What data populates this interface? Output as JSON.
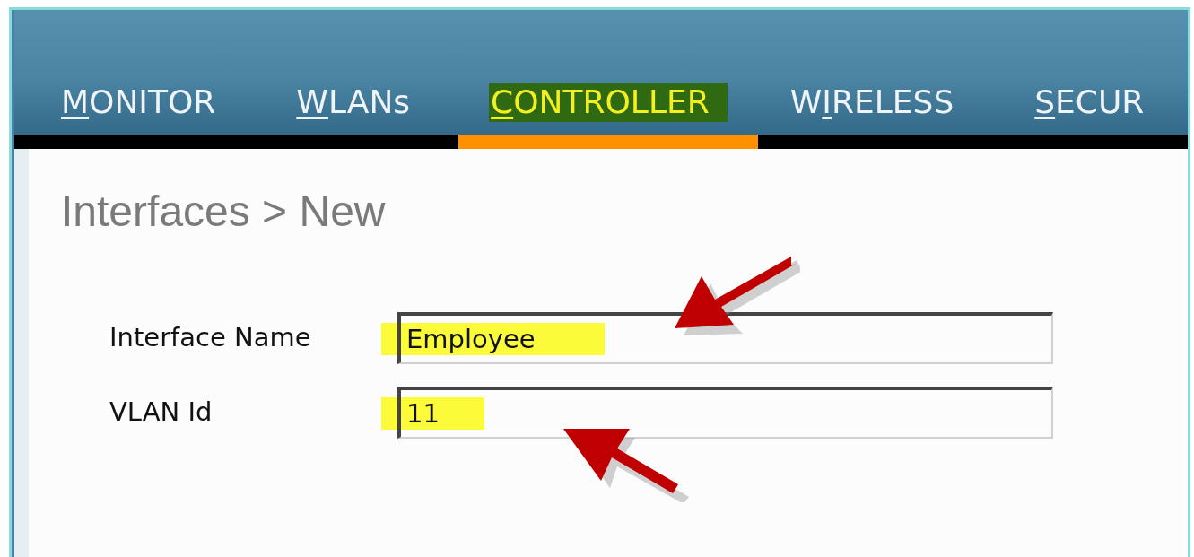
{
  "tabs": [
    {
      "key": "M",
      "post": "ONITOR",
      "selected": false
    },
    {
      "key": "W",
      "post": "LANs",
      "selected": false
    },
    {
      "key": "C",
      "post": "ONTROLLER",
      "selected": true
    },
    {
      "pre": "W",
      "key": "I",
      "post": "RELESS",
      "selected": false
    },
    {
      "key": "S",
      "post": "ECUR",
      "selected": false
    }
  ],
  "page_title": "Interfaces > New",
  "fields": [
    {
      "label": "Interface Name",
      "value": "Employee",
      "highlighted": true,
      "arrow": true
    },
    {
      "label": "VLAN Id",
      "value": "11",
      "highlighted": true,
      "arrow": true
    }
  ]
}
